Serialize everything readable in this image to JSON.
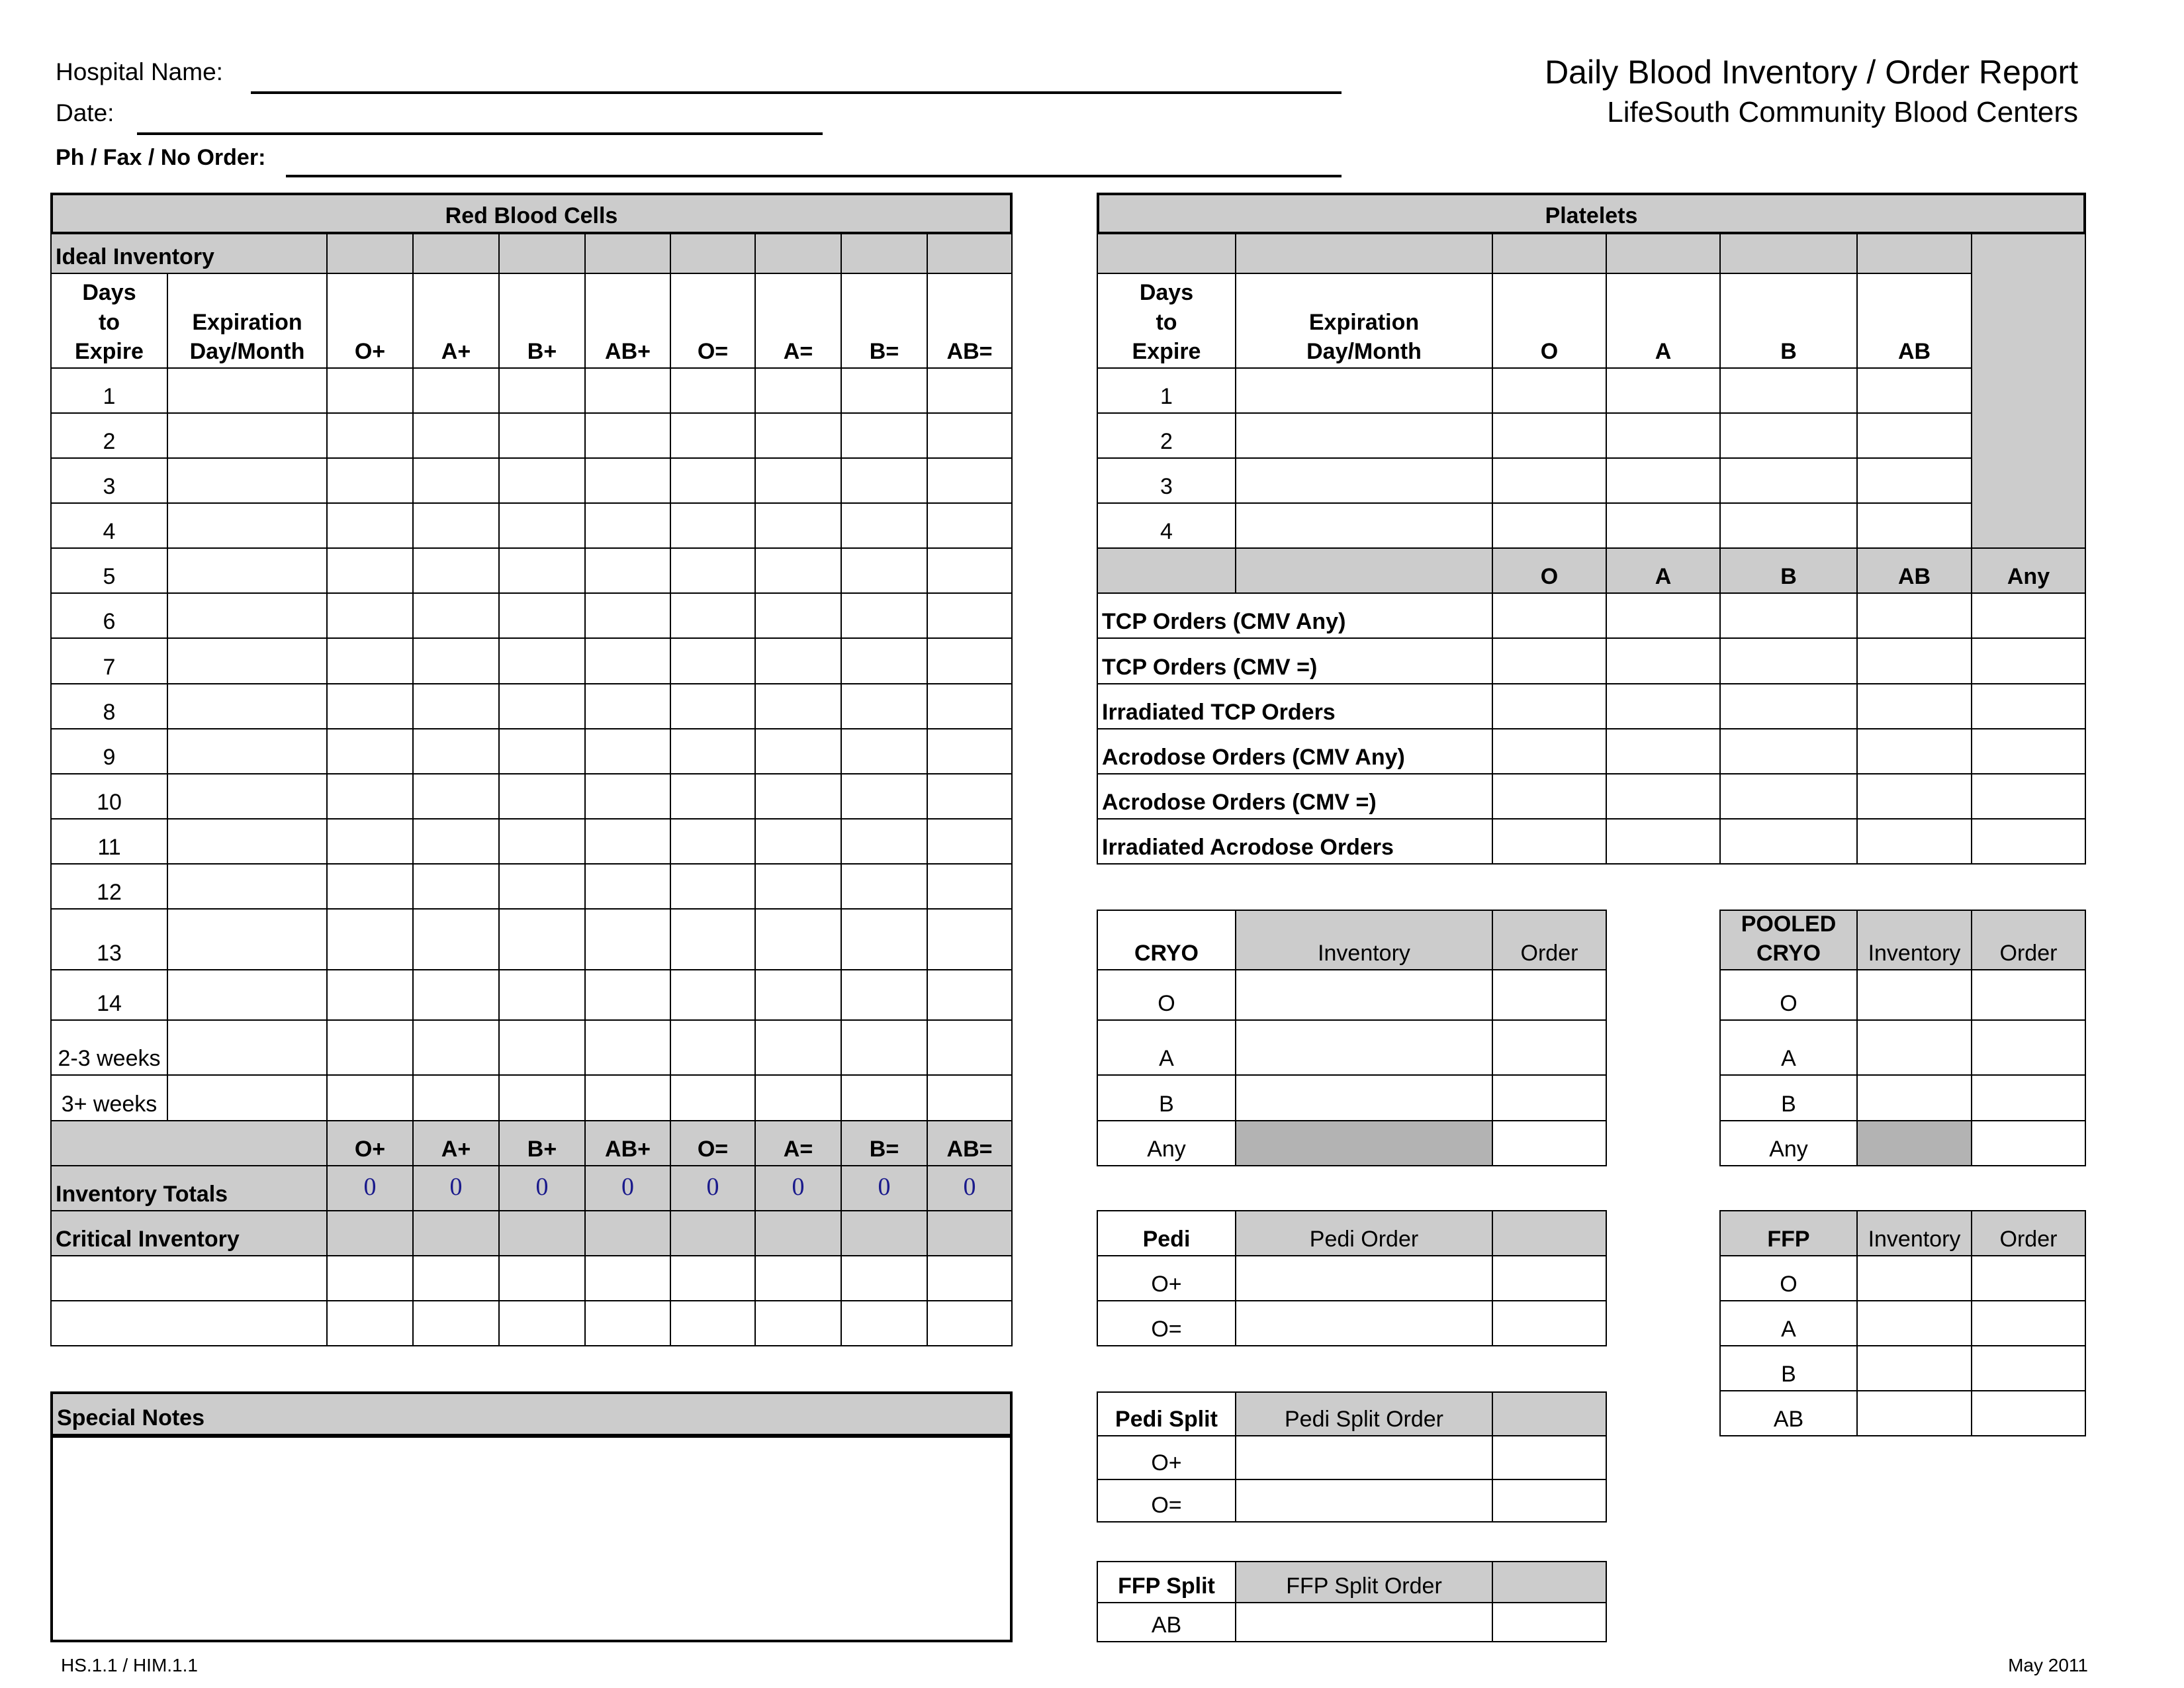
{
  "header": {
    "hospital_name_label": "Hospital Name:",
    "date_label": "Date:",
    "ph_fax_label": "Ph / Fax / No Order:",
    "title": "Daily Blood Inventory / Order Report",
    "subtitle": "LifeSouth Community Blood Centers"
  },
  "rbc": {
    "title": "Red Blood Cells",
    "ideal_label": "Ideal Inventory",
    "header_days": "Days\nto\nExpire",
    "header_exp": "Expiration\nDay/Month",
    "blood_types": [
      "O+",
      "A+",
      "B+",
      "AB+",
      "O=",
      "A=",
      "B=",
      "AB="
    ],
    "day_rows": [
      "1",
      "2",
      "3",
      "4",
      "5",
      "6",
      "7",
      "8",
      "9",
      "10",
      "11",
      "12",
      "13",
      "14",
      "2-3 weeks",
      "3+ weeks"
    ],
    "totals_label": "Inventory Totals",
    "totals": [
      "0",
      "0",
      "0",
      "0",
      "0",
      "0",
      "0",
      "0"
    ],
    "critical_label": "Critical Inventory"
  },
  "platelets": {
    "title": "Platelets",
    "header_days": "Days\nto\nExpire",
    "header_exp": "Expiration\nDay/Month",
    "types": [
      "O",
      "A",
      "B",
      "AB"
    ],
    "day_rows": [
      "1",
      "2",
      "3",
      "4"
    ],
    "order_types": [
      "O",
      "A",
      "B",
      "AB",
      "Any"
    ],
    "order_rows": [
      "TCP Orders (CMV Any)",
      "TCP Orders (CMV =)",
      "Irradiated TCP Orders",
      "Acrodose Orders (CMV Any)",
      "Acrodose Orders (CMV =)",
      "Irradiated Acrodose Orders"
    ]
  },
  "cryo": {
    "header": [
      "CRYO",
      "Inventory",
      "Order"
    ],
    "rows": [
      "O",
      "A",
      "B",
      "Any"
    ]
  },
  "pooled_cryo": {
    "header": [
      "POOLED\nCRYO",
      "Inventory",
      "Order"
    ],
    "rows": [
      "O",
      "A",
      "B",
      "Any"
    ]
  },
  "pedi": {
    "header": [
      "Pedi",
      "Pedi Order"
    ],
    "rows": [
      "O+",
      "O="
    ]
  },
  "ffp": {
    "header": [
      "FFP",
      "Inventory",
      "Order"
    ],
    "rows": [
      "O",
      "A",
      "B",
      "AB"
    ]
  },
  "pedi_split": {
    "header": [
      "Pedi Split",
      "Pedi Split Order"
    ],
    "rows": [
      "O+",
      "O="
    ]
  },
  "ffp_split": {
    "header": [
      "FFP Split",
      "FFP Split Order"
    ],
    "rows": [
      "AB"
    ]
  },
  "special_notes": {
    "title": "Special Notes"
  },
  "footer": {
    "form_code": "HS.1.1 / HIM.1.1",
    "date": "May 2011"
  },
  "colors": {
    "header_fill": "#cccccc",
    "disabled_fill": "#b3b3b3",
    "totals_text": "#1a1a8c"
  }
}
